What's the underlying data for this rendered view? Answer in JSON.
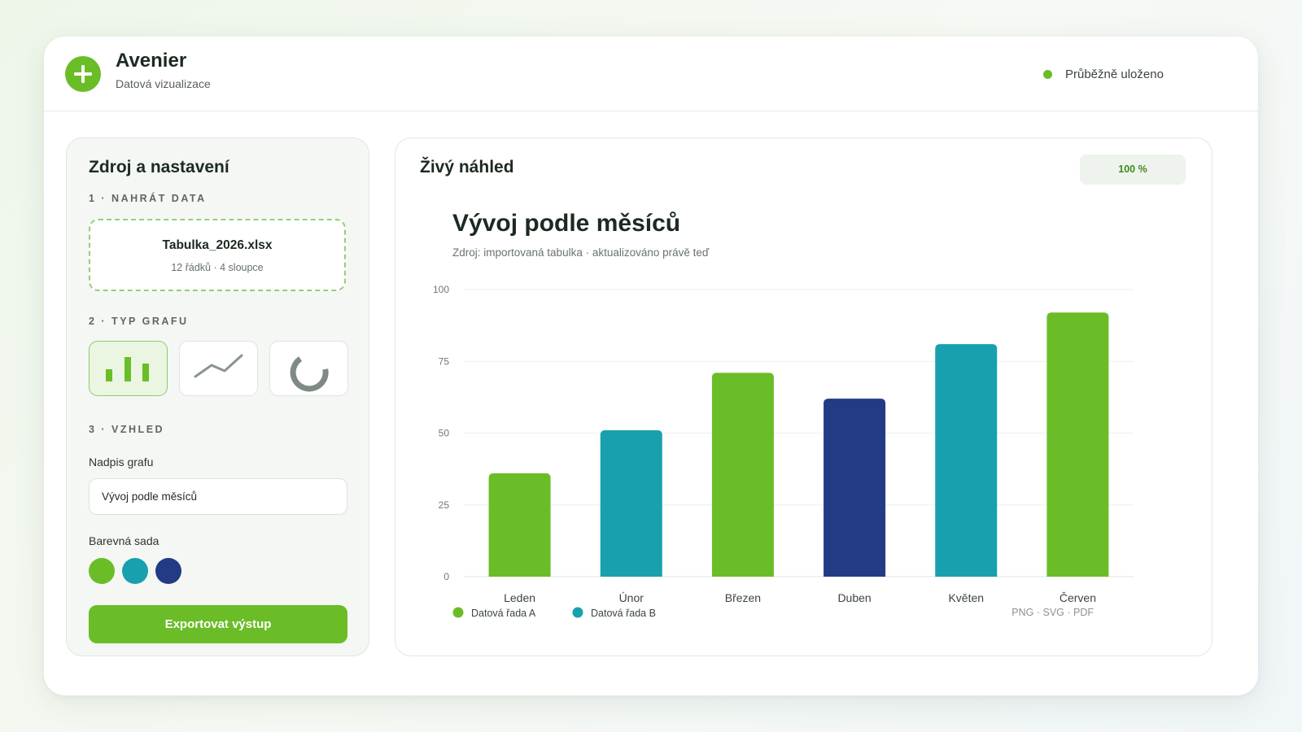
{
  "app": {
    "title": "Avenier",
    "subtitle": "Datová vizualizace",
    "save_status": "Průběžně uloženo"
  },
  "sidebar": {
    "title": "Zdroj a nastavení",
    "step1_label": "1 · NAHRÁT DATA",
    "file": {
      "name": "Tabulka_2026.xlsx",
      "meta": "12 řádků · 4 sloupce"
    },
    "step2_label": "2 · TYP GRAFU",
    "chart_types": [
      {
        "icon": "bar-chart-icon",
        "selected": true
      },
      {
        "icon": "line-chart-icon",
        "selected": false
      },
      {
        "icon": "donut-chart-icon",
        "selected": false
      }
    ],
    "step3_label": "3 · VZHLED",
    "title_field_label": "Nadpis grafu",
    "title_field_value": "Vývoj podle měsíců",
    "palette_label": "Barevná sada",
    "palette": [
      "#6abd27",
      "#19a0ae",
      "#233a85"
    ],
    "export_label": "Exportovat výstup"
  },
  "preview": {
    "title": "Živý náhled",
    "zoom": "100 %",
    "export_formats": "PNG · SVG · PDF"
  },
  "colors": {
    "accent": "#6abd27",
    "teal": "#19a0ae",
    "navy": "#233a85"
  },
  "chart_data": {
    "type": "bar",
    "title": "Vývoj podle měsíců",
    "subtitle": "Zdroj: importovaná tabulka · aktualizováno právě teď",
    "xlabel": "",
    "ylabel": "",
    "categories": [
      "Leden",
      "Únor",
      "Březen",
      "Duben",
      "Květen",
      "Červen"
    ],
    "values": [
      36,
      51,
      71,
      62,
      81,
      92
    ],
    "bar_colors": [
      "#6abd27",
      "#19a0ae",
      "#6abd27",
      "#233a85",
      "#19a0ae",
      "#6abd27"
    ],
    "ylim": [
      0,
      100
    ],
    "yticks": [
      0,
      25,
      50,
      75,
      100
    ],
    "grid": true,
    "legend": [
      {
        "name": "Datová řada A",
        "color": "#6abd27"
      },
      {
        "name": "Datová řada B",
        "color": "#19a0ae"
      }
    ],
    "legend_position": "bottom-left"
  }
}
